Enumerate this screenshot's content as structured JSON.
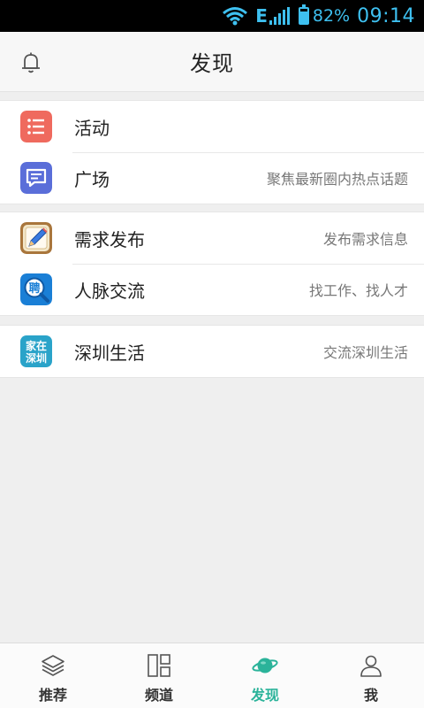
{
  "status_bar": {
    "network_type": "E",
    "battery_percent": "82%",
    "battery_level": 0.82,
    "time": "09:14",
    "color": "#3ec0f0",
    "icons": [
      "wifi-icon",
      "signal-icon",
      "battery-icon"
    ]
  },
  "header": {
    "title": "发现",
    "left_icon": "bell-icon"
  },
  "groups": [
    {
      "items": [
        {
          "label": "活动",
          "desc": "",
          "icon": "activity-list-icon",
          "icon_color": "#ef6a5e"
        },
        {
          "label": "广场",
          "desc": "聚焦最新圈内热点话题",
          "icon": "chat-bubble-icon",
          "icon_color": "#5a6ed9"
        }
      ]
    },
    {
      "items": [
        {
          "label": "需求发布",
          "desc": "发布需求信息",
          "icon": "pencil-notepad-icon",
          "icon_color": "#c79a55"
        },
        {
          "label": "人脉交流",
          "desc": "找工作、找人才",
          "icon": "recruit-search-icon",
          "icon_color": "#1a7fd6"
        }
      ]
    },
    {
      "items": [
        {
          "label": "深圳生活",
          "desc": "交流深圳生活",
          "icon": "shenzhen-life-icon",
          "icon_color": "#2aa3c9",
          "icon_text": [
            "家在",
            "深圳"
          ]
        }
      ]
    }
  ],
  "tabbar": {
    "active_color": "#2bb39a",
    "tabs": [
      {
        "label": "推荐",
        "icon": "layers-icon",
        "active": false
      },
      {
        "label": "频道",
        "icon": "channel-grid-icon",
        "active": false
      },
      {
        "label": "发现",
        "icon": "planet-icon",
        "active": true
      },
      {
        "label": "我",
        "icon": "user-icon",
        "active": false
      }
    ]
  }
}
